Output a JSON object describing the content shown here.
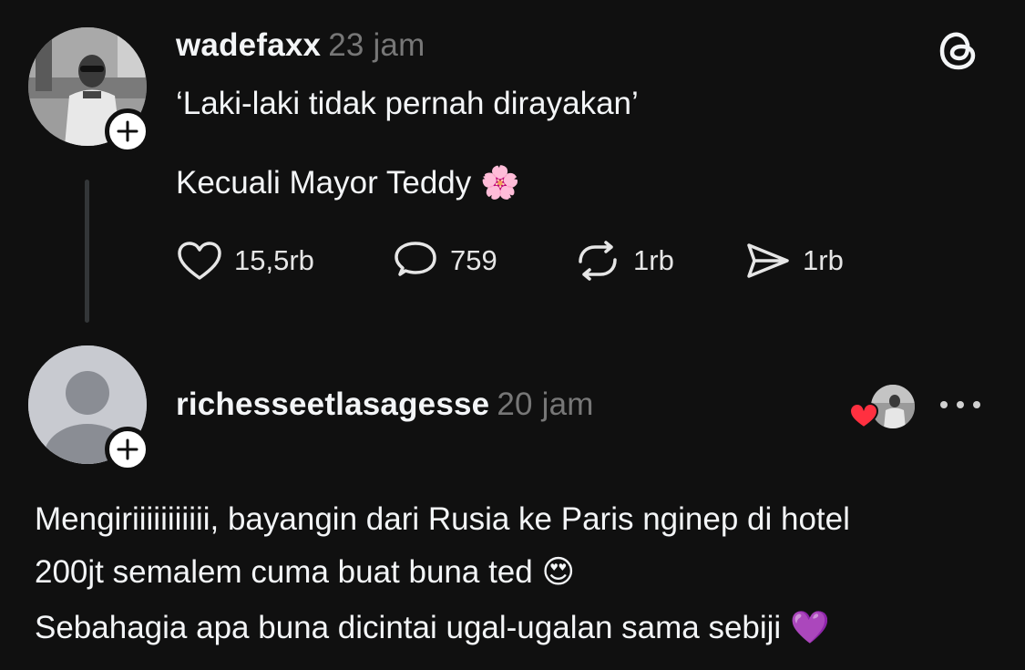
{
  "post": {
    "username": "wadefaxx",
    "time": "23 jam",
    "line1": "‘Laki-laki tidak pernah dirayakan’",
    "line2": "Kecuali Mayor Teddy",
    "emoji": "🌸",
    "actions": {
      "likes": "15,5rb",
      "replies": "759",
      "reposts": "1rb",
      "shares": "1rb"
    }
  },
  "reply": {
    "username": "richesseetlasagesse",
    "time": "20 jam",
    "line1": "Mengiriiiiiiiiiii, bayangin dari Rusia ke Paris nginep di hotel",
    "line2": "200jt semalem cuma buat buna ted",
    "line2_emoji": "😍",
    "line3": "Sebahagia apa buna dicintai ugal-ugalan sama sebiji",
    "line3_emoji": "💜"
  },
  "icons": {
    "app_logo": "threads-icon",
    "follow": "plus-icon",
    "like": "heart-outline-icon",
    "reply": "comment-icon",
    "repost": "repost-icon",
    "share": "send-icon",
    "liked_by_author": "heart-filled-icon",
    "more": "more-horizontal-icon"
  },
  "colors": {
    "background": "#101010",
    "text": "#f3f5f7",
    "muted": "#777777",
    "heart": "#ff3040",
    "thread_line": "#333638"
  }
}
